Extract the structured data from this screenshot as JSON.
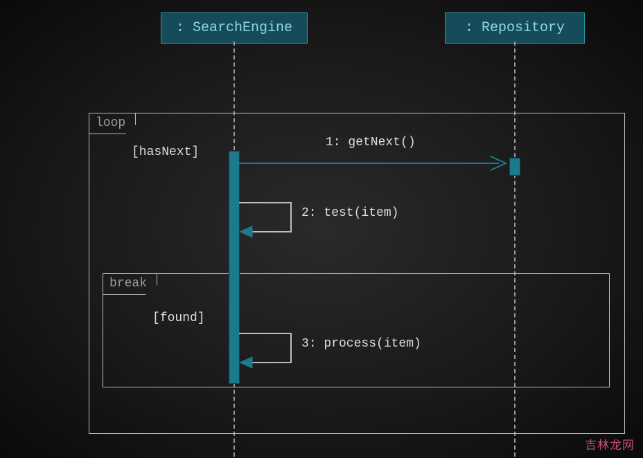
{
  "participants": {
    "searchEngine": ": SearchEngine",
    "repository": ": Repository"
  },
  "frames": {
    "loop": {
      "tag": "loop",
      "guard": "[hasNext]"
    },
    "break": {
      "tag": "break",
      "guard": "[found]"
    }
  },
  "messages": {
    "m1": "1: getNext()",
    "m2": "2: test(item)",
    "m3": "3: process(item)"
  },
  "watermark": "吉林龙网",
  "chart_data": {
    "type": "uml-sequence-diagram",
    "participants": [
      "SearchEngine",
      "Repository"
    ],
    "fragments": [
      {
        "type": "loop",
        "guard": "hasNext",
        "messages": [
          {
            "seq": 1,
            "from": "SearchEngine",
            "to": "Repository",
            "label": "getNext()",
            "kind": "sync"
          },
          {
            "seq": 2,
            "from": "SearchEngine",
            "to": "SearchEngine",
            "label": "test(item)",
            "kind": "self"
          }
        ],
        "fragments": [
          {
            "type": "break",
            "guard": "found",
            "messages": [
              {
                "seq": 3,
                "from": "SearchEngine",
                "to": "SearchEngine",
                "label": "process(item)",
                "kind": "self"
              }
            ]
          }
        ]
      }
    ]
  }
}
